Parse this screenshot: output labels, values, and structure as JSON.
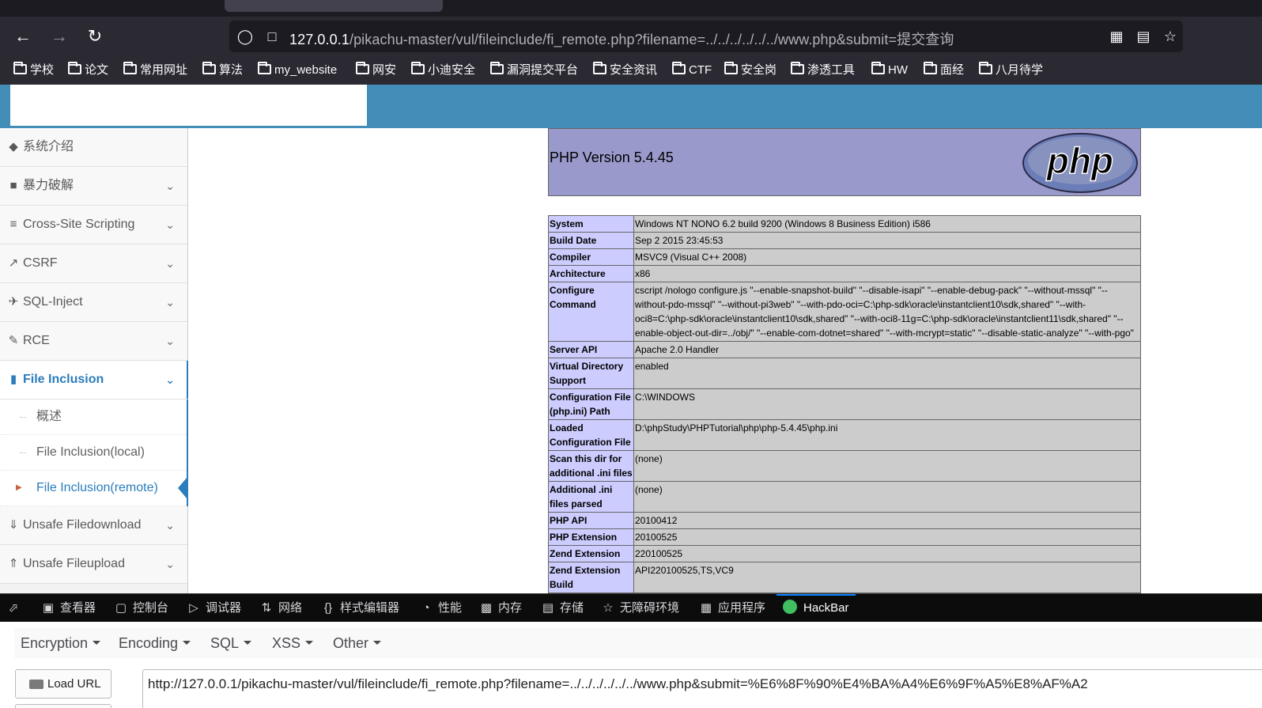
{
  "browser": {
    "url_host": "127.0.0.1",
    "url_path": "/pikachu-master/vul/fileinclude/fi_remote.php?filename=../../../../../../www.php&submit=提交查询",
    "bookmarks": [
      "学校",
      "论文",
      "常用网址",
      "算法",
      "my_website",
      "网安",
      "小迪安全",
      "漏洞提交平台",
      "安全资讯",
      "CTF",
      "安全岗",
      "渗透工具",
      "HW",
      "面经",
      "八月待学"
    ]
  },
  "sidebar": {
    "items": [
      {
        "label": "系统介绍",
        "icon": "tag-icon"
      },
      {
        "label": "暴力破解",
        "icon": "lock-icon"
      },
      {
        "label": "Cross-Site Scripting",
        "icon": "list-icon"
      },
      {
        "label": "CSRF",
        "icon": "share-icon"
      },
      {
        "label": "SQL-Inject",
        "icon": "plane-icon"
      },
      {
        "label": "RCE",
        "icon": "pencil-icon"
      },
      {
        "label": "File Inclusion",
        "icon": "file-icon"
      },
      {
        "label": "Unsafe Filedownload",
        "icon": "download-icon"
      },
      {
        "label": "Unsafe Fileupload",
        "icon": "upload-icon"
      }
    ],
    "subitems": [
      "概述",
      "File Inclusion(local)",
      "File Inclusion(remote)"
    ]
  },
  "phpinfo": {
    "version": "PHP Version 5.4.45",
    "logo_text": "php",
    "rows": [
      {
        "k": "System",
        "v": "Windows NT NONO 6.2 build 9200 (Windows 8 Business Edition) i586"
      },
      {
        "k": "Build Date",
        "v": "Sep 2 2015 23:45:53"
      },
      {
        "k": "Compiler",
        "v": "MSVC9 (Visual C++ 2008)"
      },
      {
        "k": "Architecture",
        "v": "x86"
      },
      {
        "k": "Configure Command",
        "v": "cscript /nologo configure.js \"--enable-snapshot-build\" \"--disable-isapi\" \"--enable-debug-pack\" \"--without-mssql\" \"--without-pdo-mssql\" \"--without-pi3web\" \"--with-pdo-oci=C:\\php-sdk\\oracle\\instantclient10\\sdk,shared\" \"--with-oci8=C:\\php-sdk\\oracle\\instantclient10\\sdk,shared\" \"--with-oci8-11g=C:\\php-sdk\\oracle\\instantclient11\\sdk,shared\" \"--enable-object-out-dir=../obj/\" \"--enable-com-dotnet=shared\" \"--with-mcrypt=static\" \"--disable-static-analyze\" \"--with-pgo\""
      },
      {
        "k": "Server API",
        "v": "Apache 2.0 Handler"
      },
      {
        "k": "Virtual Directory Support",
        "v": "enabled"
      },
      {
        "k": "Configuration File (php.ini) Path",
        "v": "C:\\WINDOWS"
      },
      {
        "k": "Loaded Configuration File",
        "v": "D:\\phpStudy\\PHPTutorial\\php\\php-5.4.45\\php.ini"
      },
      {
        "k": "Scan this dir for additional .ini files",
        "v": "(none)"
      },
      {
        "k": "Additional .ini files parsed",
        "v": "(none)"
      },
      {
        "k": "PHP API",
        "v": "20100412"
      },
      {
        "k": "PHP Extension",
        "v": "20100525"
      },
      {
        "k": "Zend Extension",
        "v": "220100525"
      },
      {
        "k": "Zend Extension Build",
        "v": "API220100525,TS,VC9"
      }
    ]
  },
  "devtools": {
    "tabs": [
      "查看器",
      "控制台",
      "调试器",
      "网络",
      "样式编辑器",
      "性能",
      "内存",
      "存储",
      "无障碍环境",
      "应用程序",
      "HackBar"
    ],
    "selected": "HackBar"
  },
  "hackbar": {
    "menus": [
      "Encryption",
      "Encoding",
      "SQL",
      "XSS",
      "Other"
    ],
    "load_url": "Load URL",
    "url_value": "http://127.0.0.1/pikachu-master/vul/fileinclude/fi_remote.php?filename=../../../../../../www.php&submit=%E6%8F%90%E4%BA%A4%E6%9F%A5%E8%AF%A2"
  }
}
